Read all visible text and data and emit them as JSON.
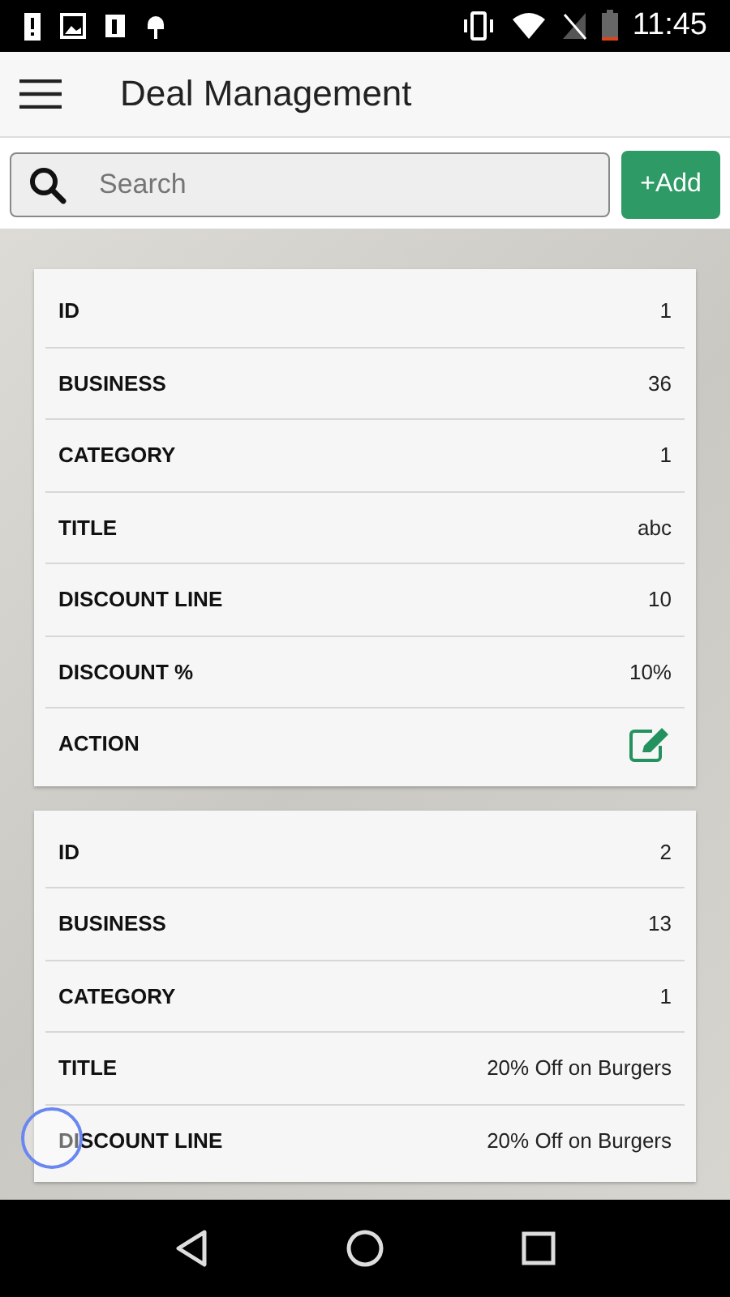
{
  "status_bar": {
    "time": "11:45"
  },
  "app_bar": {
    "title": "Deal Management"
  },
  "search": {
    "placeholder": "Search"
  },
  "add_button": "+Add",
  "deals": [
    {
      "rows": [
        {
          "kind": "text",
          "label": "ID",
          "value": "1"
        },
        {
          "kind": "text",
          "label": "BUSINESS",
          "value": "36"
        },
        {
          "kind": "text",
          "label": "CATEGORY",
          "value": "1"
        },
        {
          "kind": "text",
          "label": "TITLE",
          "value": "abc"
        },
        {
          "kind": "text",
          "label": "DISCOUNT LINE",
          "value": "10"
        },
        {
          "kind": "text",
          "label": "DISCOUNT %",
          "value": "10%"
        },
        {
          "kind": "action",
          "label": "ACTION"
        }
      ]
    },
    {
      "rows": [
        {
          "kind": "text",
          "label": "ID",
          "value": "2"
        },
        {
          "kind": "text",
          "label": "BUSINESS",
          "value": "13"
        },
        {
          "kind": "text",
          "label": "CATEGORY",
          "value": "1"
        },
        {
          "kind": "text",
          "label": "TITLE",
          "value": "20% Off on Burgers"
        },
        {
          "kind": "text",
          "label": "DISCOUNT LINE",
          "value": "20% Off on Burgers"
        }
      ]
    }
  ]
}
